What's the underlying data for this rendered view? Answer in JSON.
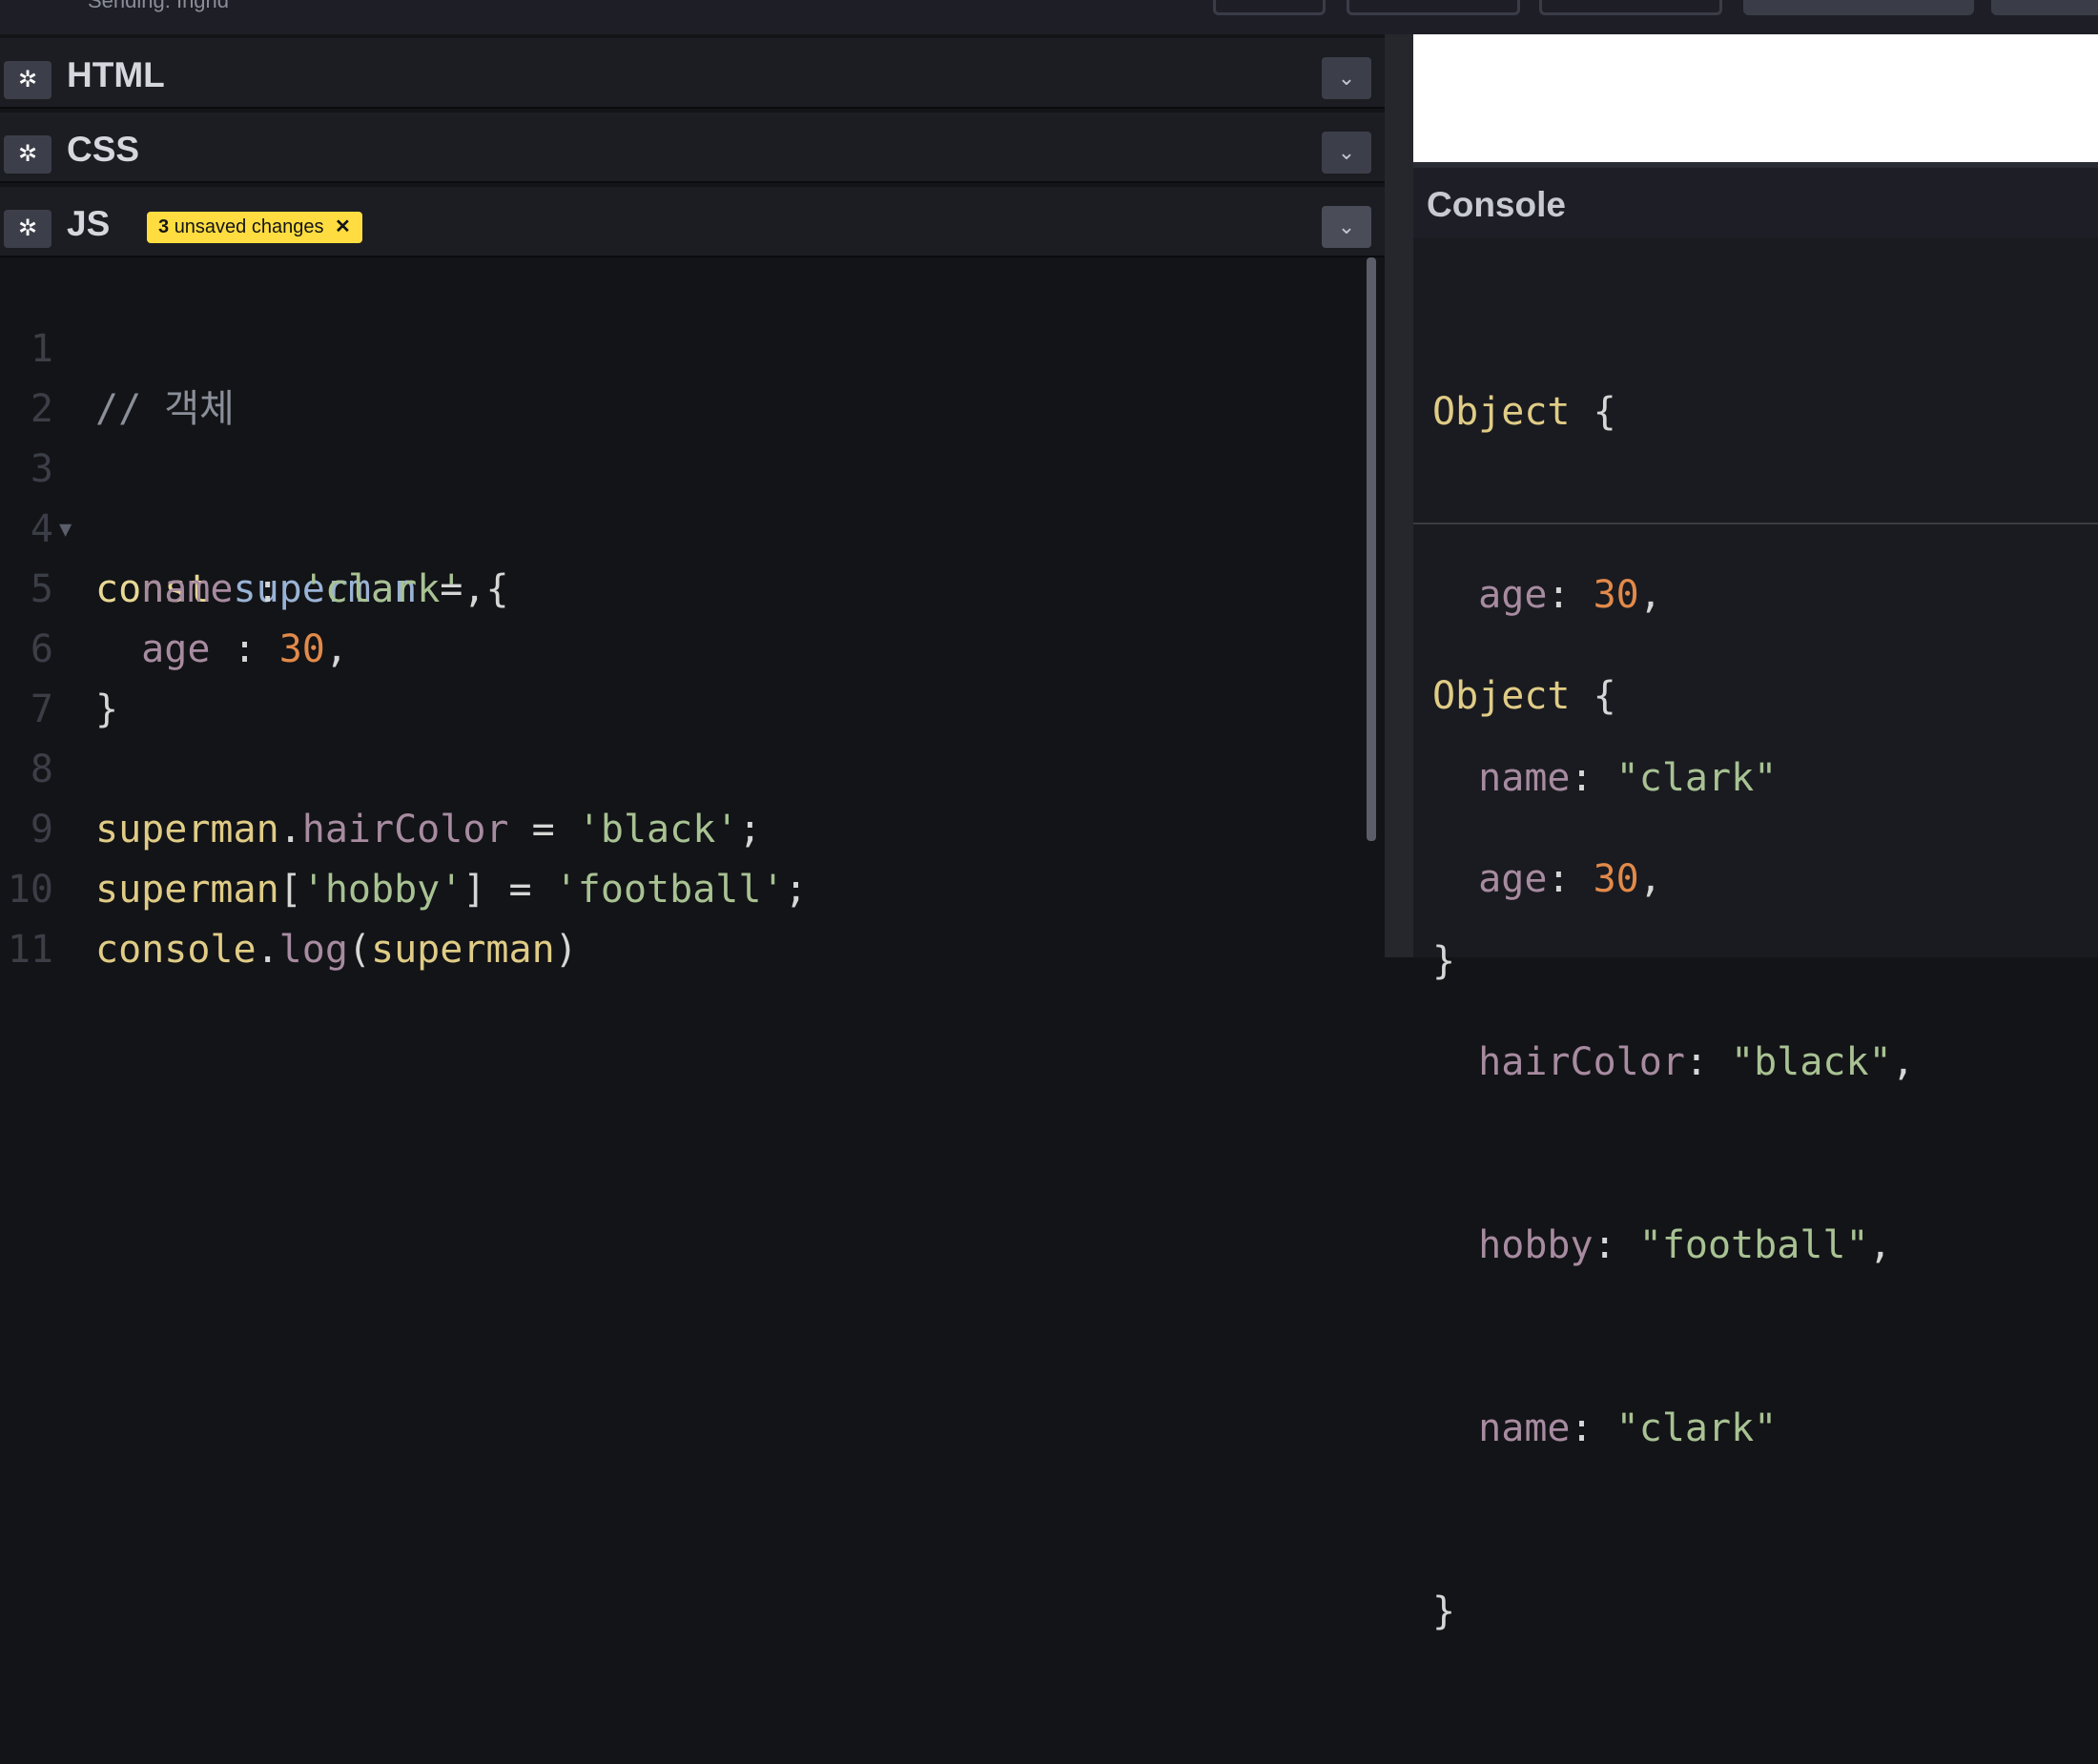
{
  "topbar": {
    "subtitle": "Sending: Ingrid"
  },
  "panels": {
    "html": {
      "title": "HTML",
      "gear_icon": "gear-icon",
      "collapse_icon": "chevron-down-icon"
    },
    "css": {
      "title": "CSS",
      "gear_icon": "gear-icon",
      "collapse_icon": "chevron-down-icon"
    },
    "js": {
      "title": "JS",
      "gear_icon": "gear-icon",
      "collapse_icon": "chevron-down-icon",
      "badge_count": "3",
      "badge_text": "unsaved changes",
      "badge_close": "✕"
    }
  },
  "editor": {
    "line_numbers": [
      "1",
      "2",
      "3",
      "4",
      "5",
      "6",
      "7",
      "8",
      "9",
      "10",
      "11"
    ],
    "lines": {
      "l1": {
        "comment": "// 객체"
      },
      "l3": {
        "kw": "const",
        "var": "superman",
        "op": "=",
        "brace": "{"
      },
      "l4": {
        "prop": "name",
        "colon": ":",
        "str": "'clark'",
        "comma": ","
      },
      "l5": {
        "prop": "age",
        "colon": ":",
        "num": "30",
        "comma": ","
      },
      "l6": {
        "brace": "}"
      },
      "l8": {
        "obj": "superman",
        "dot": ".",
        "prop": "hairColor",
        "op": "=",
        "str": "'black'",
        "end": ";"
      },
      "l9": {
        "obj": "superman",
        "open": "[",
        "key": "'hobby'",
        "close": "]",
        "op": "=",
        "str": "'football'",
        "end": ";"
      },
      "l10": {
        "obj": "console",
        "dot": ".",
        "method": "log",
        "open": "(",
        "arg": "superman",
        "close": ")"
      }
    }
  },
  "console": {
    "title": "Console",
    "log1": {
      "head": "Object",
      "open": "{",
      "entries": [
        {
          "key": "age",
          "val": "30",
          "type": "num",
          "comma": ","
        },
        {
          "key": "name",
          "val": "\"clark\"",
          "type": "str",
          "comma": ""
        }
      ],
      "close": "}"
    },
    "log2": {
      "head": "Object",
      "open": "{",
      "entries": [
        {
          "key": "age",
          "val": "30",
          "type": "num",
          "comma": ","
        },
        {
          "key": "hairColor",
          "val": "\"black\"",
          "type": "str",
          "comma": ","
        },
        {
          "key": "hobby",
          "val": "\"football\"",
          "type": "str",
          "comma": ","
        },
        {
          "key": "name",
          "val": "\"clark\"",
          "type": "str",
          "comma": ""
        }
      ],
      "close": "}"
    }
  },
  "colors": {
    "badge": "#ffdd40",
    "keyword": "#e8d894",
    "variable": "#99b3d6",
    "property": "#a78ba0",
    "string": "#a8c293",
    "number": "#e28a4a"
  }
}
